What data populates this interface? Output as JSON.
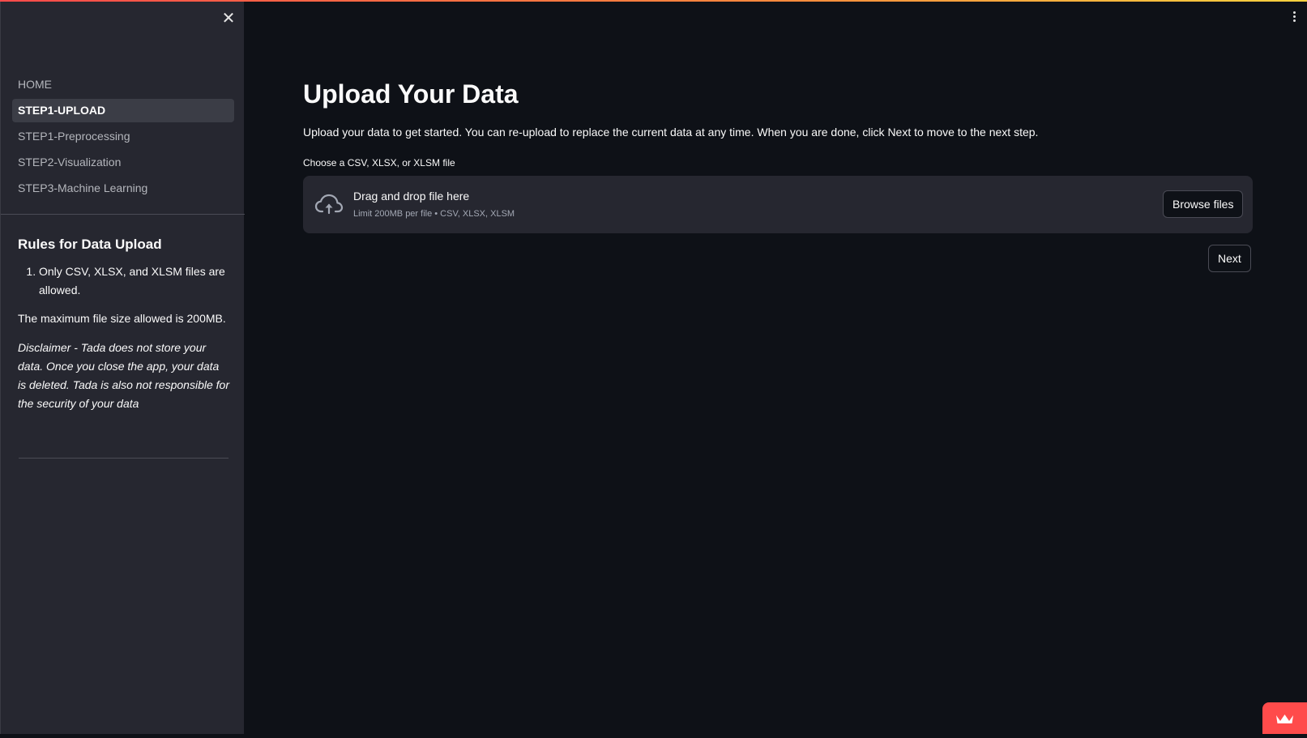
{
  "sidebar": {
    "nav_items": [
      {
        "label": "HOME",
        "active": false
      },
      {
        "label": "STEP1-UPLOAD",
        "active": true
      },
      {
        "label": "STEP1-Preprocessing",
        "active": false
      },
      {
        "label": "STEP2-Visualization",
        "active": false
      },
      {
        "label": "STEP3-Machine Learning",
        "active": false
      }
    ],
    "rules": {
      "title": "Rules for Data Upload",
      "list": [
        "Only CSV, XLSX, and XLSM files are allowed."
      ],
      "max_size": "The maximum file size allowed is 200MB.",
      "disclaimer": "Disclaimer - Tada does not store your data. Once you close the app, your data is deleted. Tada is also not responsible for the security of your data"
    }
  },
  "main": {
    "title": "Upload Your Data",
    "intro": "Upload your data to get started. You can re-upload to replace the current data at any time. When you are done, click Next to move to the next step.",
    "uploader": {
      "label": "Choose a CSV, XLSX, or XLSM file",
      "drag_text": "Drag and drop file here",
      "limit_text": "Limit 200MB per file • CSV, XLSX, XLSM",
      "browse_label": "Browse files"
    },
    "next_label": "Next"
  },
  "icons": {
    "close": "close-icon",
    "menu": "kebab-menu-icon",
    "upload": "cloud-upload-icon",
    "badge": "crown-icon"
  },
  "colors": {
    "background": "#0e1117",
    "sidebar": "#262730",
    "accent": "#ff4b4b"
  }
}
